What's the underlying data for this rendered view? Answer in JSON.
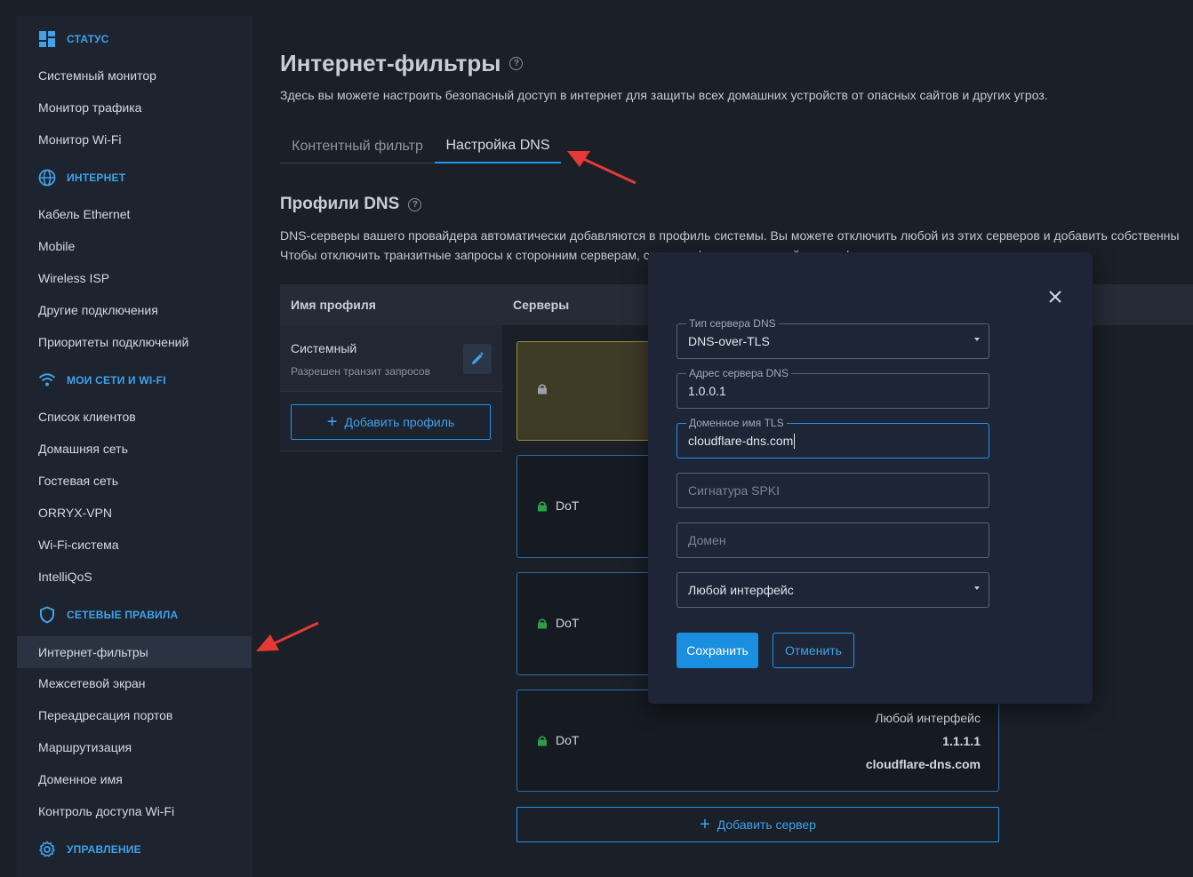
{
  "sidebar": {
    "sections": [
      {
        "title": "СТАТУС",
        "icon": "dashboard-icon",
        "items": [
          "Системный монитор",
          "Монитор трафика",
          "Монитор Wi-Fi"
        ]
      },
      {
        "title": "ИНТЕРНЕТ",
        "icon": "globe-icon",
        "items": [
          "Кабель Ethernet",
          "Mobile",
          "Wireless ISP",
          "Другие подключения",
          "Приоритеты подключений"
        ]
      },
      {
        "title": "МОИ СЕТИ И WI-FI",
        "icon": "wifi-icon",
        "items": [
          "Список клиентов",
          "Домашняя сеть",
          "Гостевая сеть",
          "ORRYX-VPN",
          "Wi-Fi-система",
          "IntelliQoS"
        ]
      },
      {
        "title": "СЕТЕВЫЕ ПРАВИЛА",
        "icon": "shield-icon",
        "items": [
          "Интернет-фильтры",
          "Межсетевой экран",
          "Переадресация портов",
          "Маршрутизация",
          "Доменное имя",
          "Контроль доступа Wi-Fi"
        ]
      },
      {
        "title": "УПРАВЛЕНИЕ",
        "icon": "gear-icon",
        "items": []
      }
    ],
    "active_item": "Интернет-фильтры"
  },
  "page": {
    "title": "Интернет-фильтры",
    "description": "Здесь вы можете настроить безопасный доступ в интернет для защиты всех домашних устройств от опасных сайтов и других угроз.",
    "tabs": [
      "Контентный фильтр",
      "Настройка DNS"
    ],
    "active_tab": "Настройка DNS"
  },
  "dns_profiles": {
    "title": "Профили DNS",
    "description_line1": "DNS-серверы вашего провайдера автоматически добавляются в профиль системы. Вы можете отключить любой из этих серверов и добавить собственны",
    "description_line2": "Чтобы отключить транзитные запросы к сторонним серверам, снимите флажок в настройках профиля.",
    "col_profile": "Имя профиля",
    "col_servers": "Серверы",
    "profile_name": "Системный",
    "profile_sub": "Разрешен транзит запросов",
    "add_profile": "Добавить профиль",
    "servers": [
      {
        "type": "",
        "system": true
      },
      {
        "type": "DoT"
      },
      {
        "type": "DoT"
      },
      {
        "type": "DoT",
        "interface": "Любой интерфейс",
        "address": "1.1.1.1",
        "domain": "cloudflare-dns.com"
      }
    ],
    "add_server": "Добавить сервер"
  },
  "modal": {
    "server_type_label": "Тип сервера DNS",
    "server_type_value": "DNS-over-TLS",
    "address_label": "Адрес сервера DNS",
    "address_value": "1.0.0.1",
    "tls_label": "Доменное имя TLS",
    "tls_value": "cloudflare-dns.com",
    "spki_placeholder": "Сигнатура SPKI",
    "domain_placeholder": "Домен",
    "interface_value": "Любой интерфейс",
    "save_label": "Сохранить",
    "cancel_label": "Отменить"
  },
  "colors": {
    "accent": "#2196e8",
    "annotation_arrow": "#e53935",
    "lock_green": "#2e9e44"
  }
}
